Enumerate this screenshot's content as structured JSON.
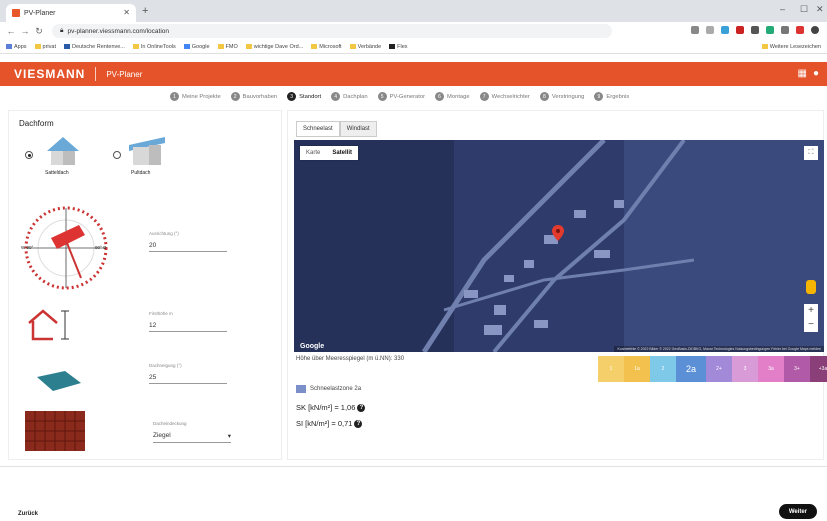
{
  "browser": {
    "tab_title": "PV-Planer",
    "url": "pv-planner.viessmann.com/location",
    "bookmarks": [
      "Apps",
      "privat",
      "Deutsche Rentenve...",
      "In OnlineTools",
      "Google",
      "FMO",
      "wichtige Dave Ord...",
      "Microsoft",
      "Verbände",
      "Flex"
    ],
    "other_bookmarks": "Weitere Lesezeichen"
  },
  "app": {
    "logo": "VIESMANN",
    "name": "PV-Planer",
    "accent": "#e4532a"
  },
  "steps": [
    {
      "num": "1",
      "label": "Meine Projekte"
    },
    {
      "num": "2",
      "label": "Bauvorhaben"
    },
    {
      "num": "3",
      "label": "Standort"
    },
    {
      "num": "4",
      "label": "Dachplan"
    },
    {
      "num": "5",
      "label": "PV-Generator"
    },
    {
      "num": "6",
      "label": "Montage"
    },
    {
      "num": "7",
      "label": "Wechselrichter"
    },
    {
      "num": "8",
      "label": "Verstringung"
    },
    {
      "num": "9",
      "label": "Ergebnis"
    }
  ],
  "active_step": "3",
  "left": {
    "title": "Dachform",
    "roof_types": [
      "Satteldach",
      "Pultdach"
    ],
    "selected_roof": "Satteldach",
    "compass_labels": {
      "west": "W 90°",
      "east": "90° O"
    },
    "fields": {
      "azimuth": {
        "label": "Ausrichtung (°)",
        "value": "20"
      },
      "ridge": {
        "label": "Firsthöhe m",
        "value": "12"
      },
      "tilt": {
        "label": "Dachneigung (°)",
        "value": "25"
      },
      "roofing": {
        "label": "Dacheindeckung",
        "value": "Ziegel"
      }
    }
  },
  "right": {
    "tabs": [
      "Schneelast",
      "Windlast"
    ],
    "active_tab": "Schneelast",
    "map_controls": [
      "Karte",
      "Satellit"
    ],
    "active_map": "Satellit",
    "google": "Google",
    "attribution": "Kurzbefehle  © 2022  Bilder © 2022 GeoBasis-DE/BKG, Maxar Technologies  Nutzungsbedingungen  Fehler bei Google Maps melden",
    "altitude": "Höhe über Meeresspiegel (m ü.NN): 330",
    "zones": [
      {
        "label": "1",
        "color": "#f5d06a"
      },
      {
        "label": "1a",
        "color": "#f3c14e"
      },
      {
        "label": "2",
        "color": "#7ec9e8"
      },
      {
        "label": "2a",
        "color": "#5b8fd6"
      },
      {
        "label": "2+",
        "color": "#a28ad9"
      },
      {
        "label": "3",
        "color": "#d99ad8"
      },
      {
        "label": "3a",
        "color": "#e27fc8"
      },
      {
        "label": "3+",
        "color": "#b05aa8"
      },
      {
        "label": "+3a",
        "color": "#8a3f78"
      }
    ],
    "active_zone": "2a",
    "legend": "Schneelastzone 2a",
    "sk": "SK [kN/m²] = 1,06",
    "si": "SI [kN/m²] = 0,71"
  },
  "footer": {
    "back": "Zurück",
    "next": "Weiter"
  }
}
